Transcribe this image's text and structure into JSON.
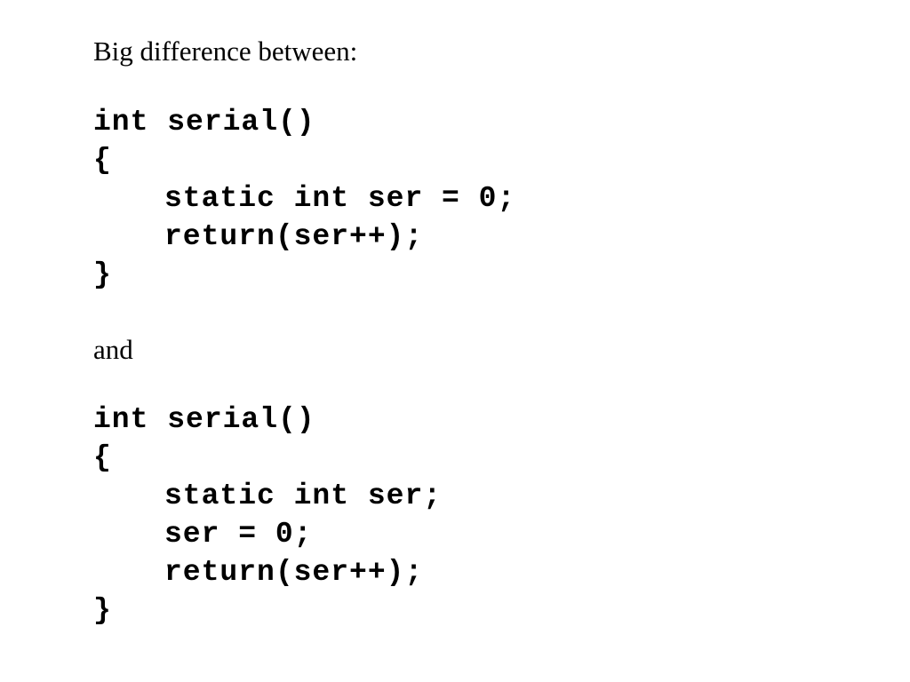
{
  "intro_text": "Big difference between:",
  "connector_text": "and",
  "snippet_a": {
    "signature": "int serial()",
    "open_brace": "{",
    "decl": "static int ser = 0;",
    "ret": "return(ser++);",
    "close_brace": "}"
  },
  "snippet_b": {
    "signature": "int serial()",
    "open_brace": "{",
    "decl": "static int ser;",
    "assign": "ser = 0;",
    "ret": "return(ser++);",
    "close_brace": "}"
  }
}
